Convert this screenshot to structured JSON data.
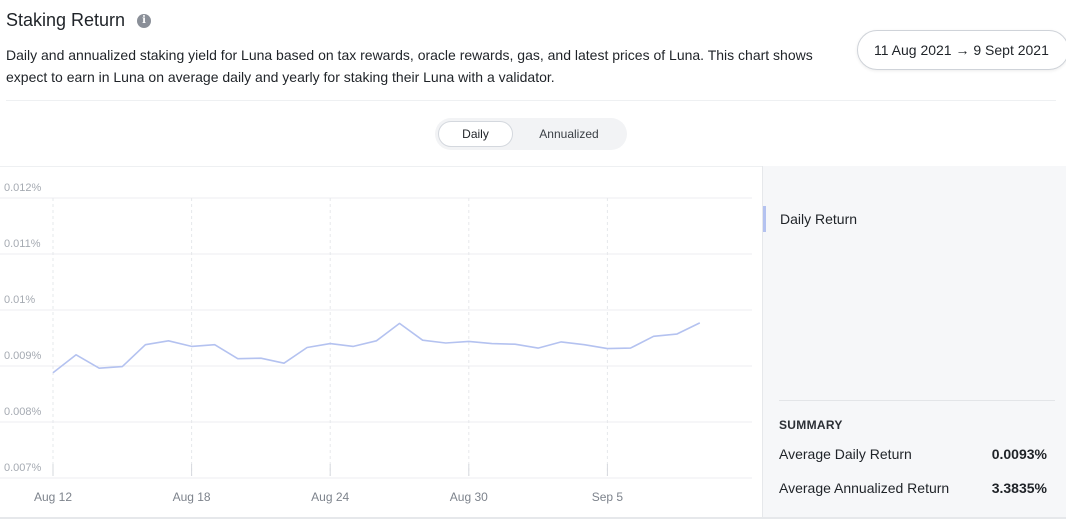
{
  "header": {
    "title": "Staking Return",
    "info_icon": "info-icon",
    "description_line1": "Daily and annualized staking yield for Luna based on tax rewards, oracle rewards, gas, and latest prices of Luna. This chart shows",
    "description_line2": "expect to earn in Luna on average daily and yearly for staking their Luna with a validator."
  },
  "date_range": {
    "label": "11 Aug 2021 → 9 Sept 2021"
  },
  "toggle": {
    "daily_label": "Daily",
    "annualized_label": "Annualized",
    "selected": "Daily"
  },
  "legend": {
    "series_label": "Daily Return",
    "swatch_color": "#b4c2f0"
  },
  "summary": {
    "title": "SUMMARY",
    "rows": [
      {
        "label": "Average Daily Return",
        "value": "0.0093%"
      },
      {
        "label": "Average Annualized Return",
        "value": "3.3835%"
      }
    ]
  },
  "chart_data": {
    "type": "line",
    "title": "",
    "xlabel": "",
    "ylabel": "",
    "ylim": [
      0.007,
      0.012
    ],
    "y_ticks": [
      "0.012%",
      "0.011%",
      "0.01%",
      "0.009%",
      "0.008%",
      "0.007%"
    ],
    "y_tick_values": [
      0.012,
      0.011,
      0.01,
      0.009,
      0.008,
      0.007
    ],
    "x_tick_labels": [
      "Aug 12",
      "Aug 18",
      "Aug 24",
      "Aug 30",
      "Sep 5"
    ],
    "x_tick_days": [
      1,
      7,
      13,
      19,
      25
    ],
    "grid": true,
    "line_color": "#b4c2f0",
    "series": [
      {
        "name": "Daily Return",
        "x": [
          "2021-08-12",
          "2021-08-13",
          "2021-08-14",
          "2021-08-15",
          "2021-08-16",
          "2021-08-17",
          "2021-08-18",
          "2021-08-19",
          "2021-08-20",
          "2021-08-21",
          "2021-08-22",
          "2021-08-23",
          "2021-08-24",
          "2021-08-25",
          "2021-08-26",
          "2021-08-27",
          "2021-08-28",
          "2021-08-29",
          "2021-08-30",
          "2021-08-31",
          "2021-09-01",
          "2021-09-02",
          "2021-09-03",
          "2021-09-04",
          "2021-09-05",
          "2021-09-06",
          "2021-09-07",
          "2021-09-08",
          "2021-09-09"
        ],
        "values": [
          0.00888,
          0.0092,
          0.00896,
          0.00899,
          0.00938,
          0.00945,
          0.00935,
          0.00938,
          0.00913,
          0.00914,
          0.00905,
          0.00933,
          0.0094,
          0.00935,
          0.00945,
          0.00976,
          0.00946,
          0.00941,
          0.00944,
          0.0094,
          0.00939,
          0.00932,
          0.00943,
          0.00938,
          0.00931,
          0.00932,
          0.00953,
          0.00957,
          0.00977
        ]
      }
    ]
  }
}
